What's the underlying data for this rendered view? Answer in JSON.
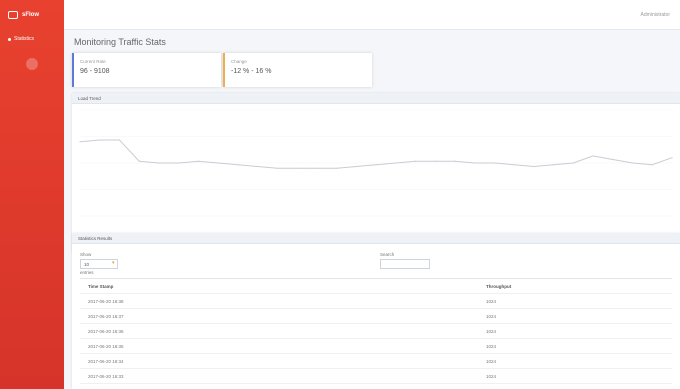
{
  "brand": {
    "name": "sFlow"
  },
  "sidebar": {
    "items": [
      {
        "label": "Statistics"
      }
    ]
  },
  "topbar": {
    "user": "Administrator"
  },
  "page": {
    "title": "Monitoring Traffic Stats"
  },
  "stats": [
    {
      "label": "Current Rate",
      "value": "96 - 9108",
      "accent": "#5b7bd5"
    },
    {
      "label": "Change",
      "value": "-12 % - 16 %",
      "accent": "#f0ad4e"
    }
  ],
  "chart": {
    "title": "Load Trend"
  },
  "chart_data": {
    "type": "line",
    "series": [
      {
        "values": [
          42,
          43,
          43,
          31,
          30,
          30,
          31,
          30,
          29,
          28,
          27,
          27,
          27,
          27,
          28,
          29,
          30,
          31,
          31,
          31,
          30,
          30,
          29,
          28,
          29,
          30,
          34,
          32,
          30,
          29,
          33
        ]
      }
    ],
    "ylim": [
      0,
      60
    ],
    "xlabel": "",
    "ylabel": "",
    "grid": true
  },
  "table_card": {
    "title": "Statistics Results",
    "filter1_label": "Show",
    "filter1_value": "10",
    "filter1_sub": "entries",
    "filter2_label": "Search",
    "filter2_value": "",
    "headers": [
      "Time Stamp",
      "Throughput"
    ],
    "rows": [
      [
        "2017-06-20 16:38",
        "1024"
      ],
      [
        "2017-06-20 16:37",
        "1024"
      ],
      [
        "2017-06-20 16:36",
        "1024"
      ],
      [
        "2017-06-20 16:35",
        "1024"
      ],
      [
        "2017-06-20 16:34",
        "1024"
      ],
      [
        "2017-06-20 16:33",
        "1024"
      ]
    ]
  }
}
